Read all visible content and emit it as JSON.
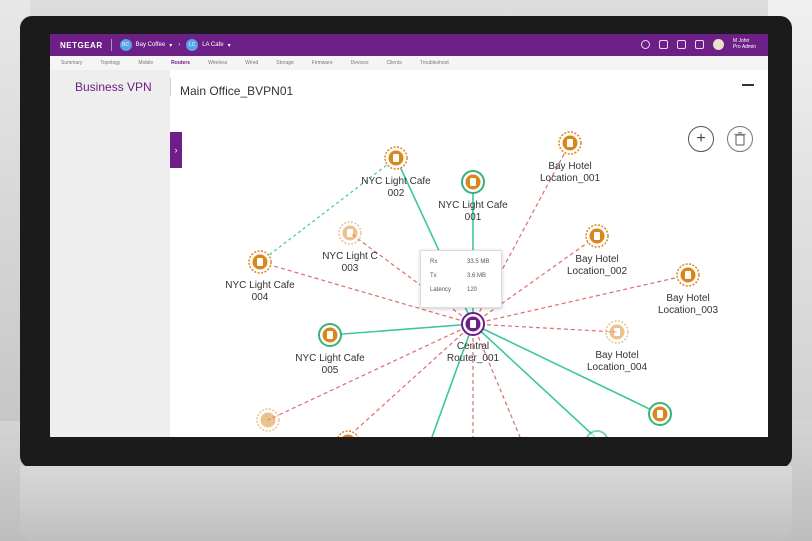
{
  "topbar": {
    "brand": "NETGEAR",
    "org_initials": "BC",
    "org": "Bay Coffee",
    "location_initials": "LC",
    "location": "LA Cafe",
    "user": "M Johri",
    "user_role": "Pro Admin"
  },
  "nav": {
    "tabs": [
      "Summary",
      "Topology",
      "Mobile",
      "Routers",
      "Wireless",
      "Wired",
      "Storage",
      "Firmware",
      "Devices",
      "Clients",
      "Troubleshoot"
    ],
    "active": "Routers"
  },
  "panel": {
    "title": "Business VPN"
  },
  "main": {
    "title": "Main Office_BVPN01"
  },
  "tooltip": {
    "rx_label": "Rx",
    "rx_value": "33.5 MB",
    "tx_label": "Tx",
    "tx_value": "3.6 MB",
    "latency_label": "Latency",
    "latency_value": "120"
  },
  "colors": {
    "brand": "#6c1f86",
    "node_orange": "#d9861c",
    "node_green": "#38b27a",
    "link_green": "#3cc79b",
    "link_red": "#e06b6b"
  },
  "topology": {
    "central": {
      "label": [
        "Central",
        "Router_001"
      ]
    },
    "nodes": [
      {
        "name": "nyc-002",
        "label": [
          "NYC Light Cafe",
          "002"
        ],
        "status": "orange"
      },
      {
        "name": "nyc-001",
        "label": [
          "NYC Light Cafe",
          "001"
        ],
        "status": "green"
      },
      {
        "name": "bay-001",
        "label": [
          "Bay Hotel",
          "Location_001"
        ],
        "status": "orange"
      },
      {
        "name": "nyc-003",
        "label": [
          "NYC Light C",
          "003"
        ],
        "status": "orange-faded"
      },
      {
        "name": "bay-002",
        "label": [
          "Bay Hotel",
          "Location_002"
        ],
        "status": "orange"
      },
      {
        "name": "nyc-004",
        "label": [
          "NYC Light Cafe",
          "004"
        ],
        "status": "orange"
      },
      {
        "name": "bay-003",
        "label": [
          "Bay Hotel",
          "Location_003"
        ],
        "status": "orange"
      },
      {
        "name": "nyc-005",
        "label": [
          "NYC Light Cafe",
          "005"
        ],
        "status": "green"
      },
      {
        "name": "bay-004",
        "label": [
          "Bay Hotel",
          "Location_004"
        ],
        "status": "orange-faded"
      }
    ]
  }
}
